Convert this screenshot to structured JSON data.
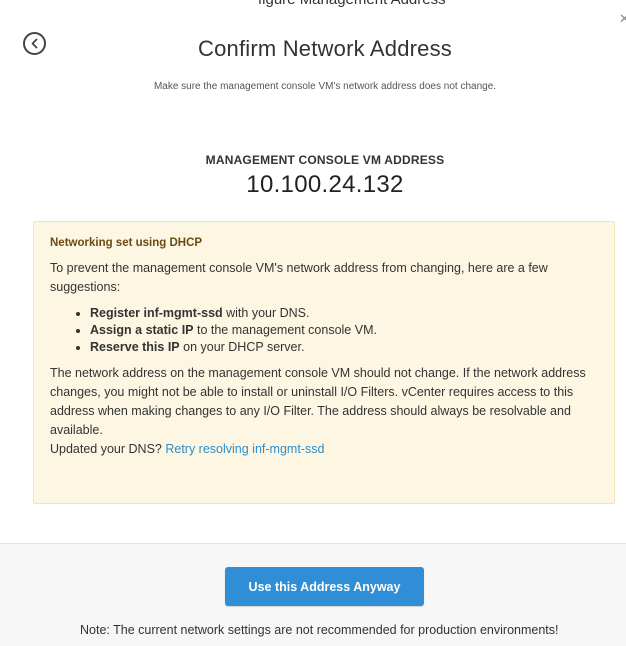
{
  "colors": {
    "primary_button": "#2f8ed6",
    "notice_background": "#fdf6e3",
    "link": "#2d8ecb",
    "footer_background": "#f7f7f7"
  },
  "header": {
    "cut_off_text": "figure Management Address",
    "back_icon": "back-arrow-circle-icon",
    "close_icon": "close-icon",
    "title": "Confirm Network Address",
    "subtitle": "Make sure the management console VM's network address does not change."
  },
  "address": {
    "label": "MANAGEMENT CONSOLE VM ADDRESS",
    "value": "10.100.24.132"
  },
  "notice": {
    "heading": "Networking set using DHCP",
    "intro": "To prevent the management console VM's network address from changing, here are a few suggestions:",
    "suggestions": [
      {
        "bold": "Register inf-mgmt-ssd",
        "rest": " with your DNS."
      },
      {
        "bold": "Assign a static IP",
        "rest": " to the management console VM."
      },
      {
        "bold": "Reserve this IP",
        "rest": " on your DHCP server."
      }
    ],
    "body": "The network address on the management console VM should not change. If the network address changes, you might not be able to install or uninstall I/O Filters. vCenter requires access to this address when making changes to any I/O Filter. The address should always be resolvable and available.",
    "retry_prefix": "Updated your DNS? ",
    "retry_link": "Retry resolving inf-mgmt-ssd"
  },
  "footer": {
    "button_label": "Use this Address Anyway",
    "note": "Note: The current network settings are not recommended for production environments!"
  }
}
